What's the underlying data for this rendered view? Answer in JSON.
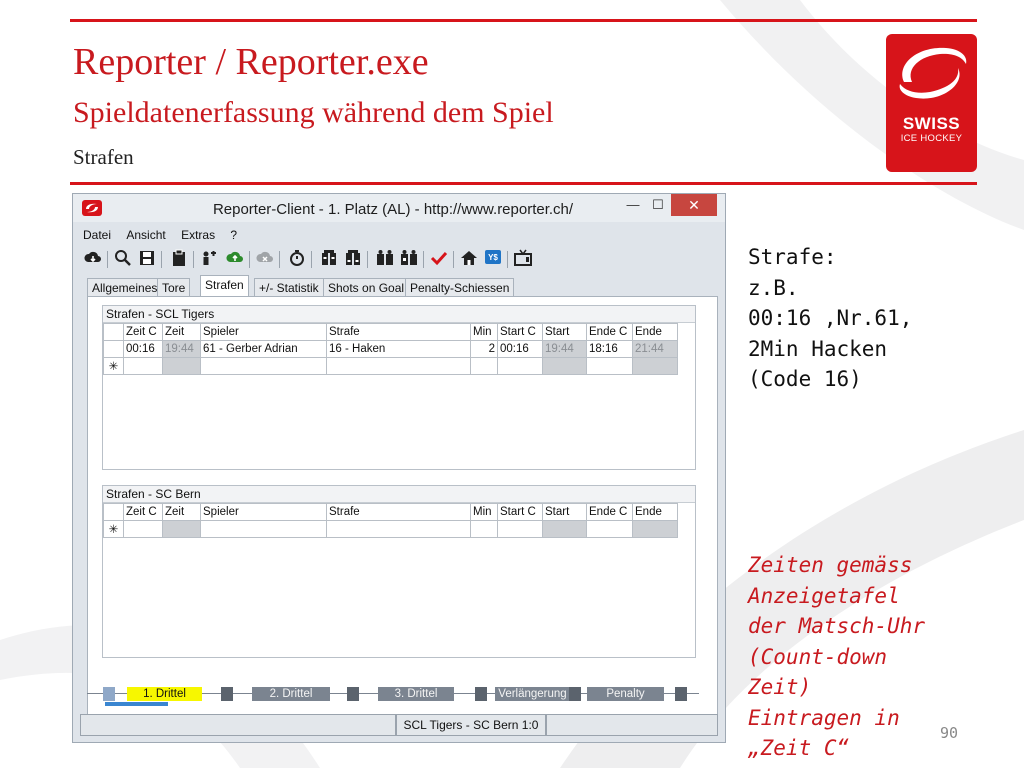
{
  "slide": {
    "title": "Reporter / Reporter.exe",
    "subtitle": "Spieldatenerfassung während dem Spiel",
    "section": "Strafen",
    "logo_line1": "SWISS",
    "logo_line2": "ICE HOCKEY",
    "note1": "Strafe:\nz.B.\n00:16 ,Nr.61,\n2Min Hacken\n(Code 16)",
    "note2": "Zeiten gemäss\nAnzeigetafel\nder Matsch-Uhr\n(Count-down\nZeit)\nEintragen in\n„Zeit C“",
    "page_number": "90",
    "accent_color": "#d7141a"
  },
  "window": {
    "title": "Reporter-Client  -  1. Platz (AL)  -  http://www.reporter.ch/",
    "minimize": "—",
    "maximize": "☐",
    "close": "✕",
    "menu": [
      "Datei",
      "Ansicht",
      "Extras",
      "?"
    ],
    "toolbar_icons": [
      "cloud-download-icon",
      "search-icon",
      "save-icon",
      "clipboard-icon",
      "players-icon",
      "cloud-upload-icon",
      "cloud-disabled-icon",
      "stopwatch-icon",
      "lineup-home-icon",
      "lineup-away-icon",
      "team-home-icon",
      "team-away-icon",
      "checkmark-icon",
      "home-icon",
      "yes-icon",
      "tv-icon"
    ],
    "tabs": [
      "Allgemeines",
      "Tore",
      "Strafen",
      "+/- Statistik",
      "Shots on Goal",
      "Penalty-Schiessen"
    ],
    "active_tab": "Strafen",
    "columns": [
      "Zeit C",
      "Zeit",
      "Spieler",
      "Strafe",
      "Min",
      "Start C",
      "Start",
      "Ende C",
      "Ende"
    ],
    "panel_home": {
      "title": "Strafen - SCL Tigers",
      "rows": [
        [
          "00:16",
          "19:44",
          "61 - Gerber Adrian",
          "16 - Haken",
          "2",
          "00:16",
          "19:44",
          "18:16",
          "21:44"
        ]
      ],
      "new_row_marker": "✳"
    },
    "panel_away": {
      "title": "Strafen - SC Bern",
      "rows": [],
      "new_row_marker": "✳"
    },
    "periods": [
      "1. Drittel",
      "2. Drittel",
      "3. Drittel",
      "Verlängerung",
      "Penalty"
    ],
    "active_period": "1. Drittel",
    "status_score": "SCL Tigers - SC Bern 1:0"
  }
}
